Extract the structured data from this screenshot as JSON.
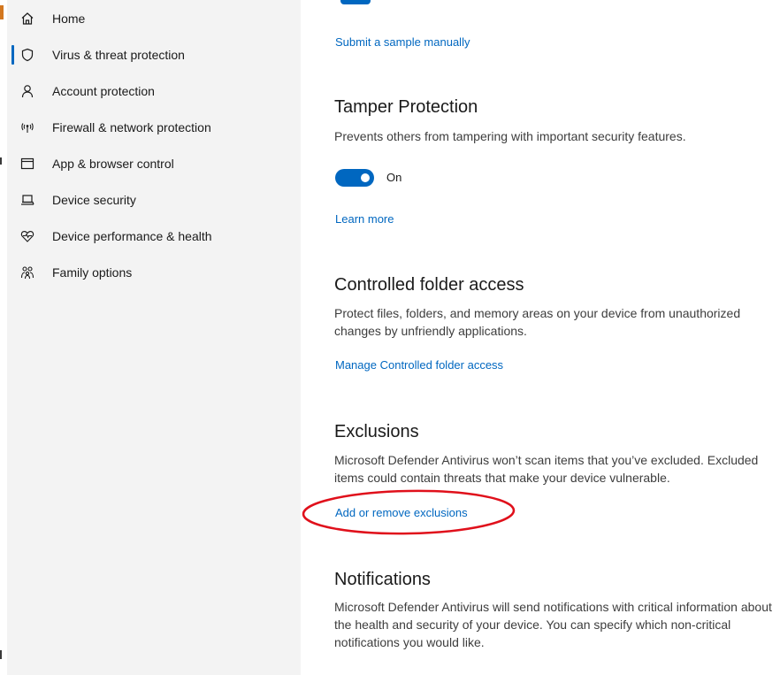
{
  "sidebar": {
    "items": [
      {
        "label": "Home",
        "icon": "home-icon"
      },
      {
        "label": "Virus & threat protection",
        "icon": "shield-icon",
        "active": true
      },
      {
        "label": "Account protection",
        "icon": "person-icon"
      },
      {
        "label": "Firewall & network protection",
        "icon": "wifi-icon"
      },
      {
        "label": "App & browser control",
        "icon": "browser-window-icon"
      },
      {
        "label": "Device security",
        "icon": "laptop-icon"
      },
      {
        "label": "Device performance & health",
        "icon": "heart-pulse-icon"
      },
      {
        "label": "Family options",
        "icon": "family-icon"
      }
    ]
  },
  "main": {
    "submit_sample_link": "Submit a sample manually",
    "tamper": {
      "title": "Tamper Protection",
      "description": "Prevents others from tampering with important security features.",
      "toggle_state": "On",
      "learn_more": "Learn more"
    },
    "controlled_folder": {
      "title": "Controlled folder access",
      "description": "Protect files, folders, and memory areas on your device from unauthorized changes by unfriendly applications.",
      "link": "Manage Controlled folder access"
    },
    "exclusions": {
      "title": "Exclusions",
      "description": "Microsoft Defender Antivirus won’t scan items that you’ve excluded. Excluded items could contain threats that make your device vulnerable.",
      "link": "Add or remove exclusions"
    },
    "notifications": {
      "title": "Notifications",
      "description": "Microsoft Defender Antivirus will send notifications with critical information about the health and security of your device. You can specify which non-critical notifications you would like."
    }
  },
  "colors": {
    "accent": "#0067c0",
    "annotation": "#e0101b",
    "sidebar_bg": "#f3f3f3"
  }
}
